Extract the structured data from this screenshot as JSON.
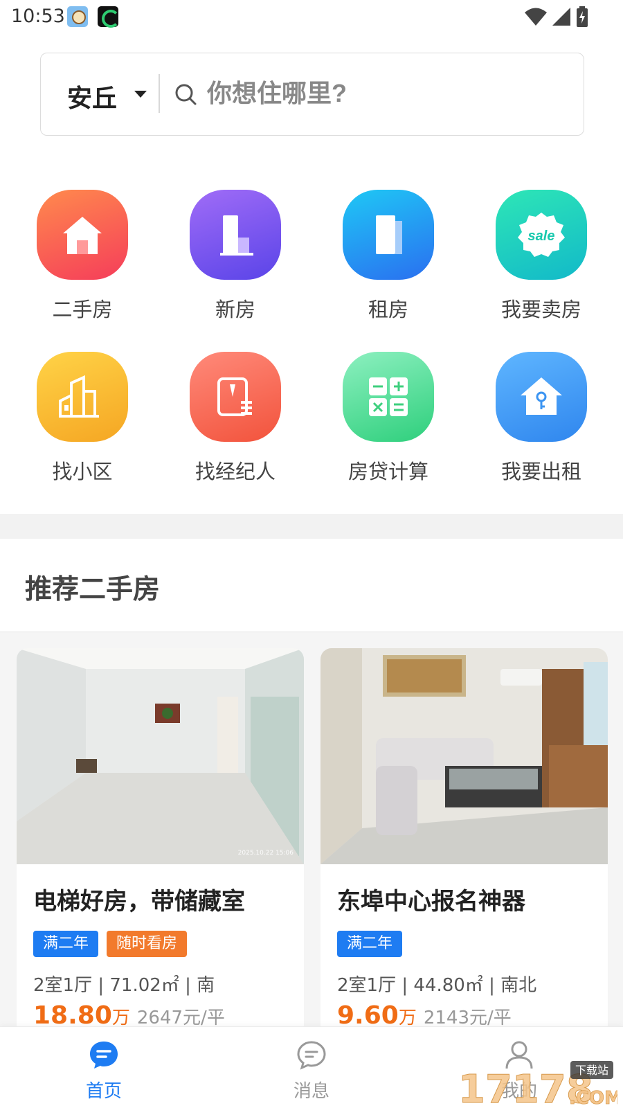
{
  "status_bar": {
    "time": "10:53"
  },
  "search": {
    "city": "安丘",
    "placeholder": "你想住哪里?"
  },
  "features": [
    {
      "label": "二手房",
      "icon": "house-icon",
      "color": "#f54d4d"
    },
    {
      "label": "新房",
      "icon": "building-icon",
      "color": "#7a5cf5"
    },
    {
      "label": "租房",
      "icon": "rent-building-icon",
      "color": "#1f8df2"
    },
    {
      "label": "我要卖房",
      "icon": "sale-badge-icon",
      "color": "#19c9ae"
    },
    {
      "label": "找小区",
      "icon": "community-icon",
      "color": "#f7b82e"
    },
    {
      "label": "找经纪人",
      "icon": "agent-icon",
      "color": "#f5634c"
    },
    {
      "label": "房贷计算",
      "icon": "calculator-icon",
      "color": "#3ecf7e"
    },
    {
      "label": "我要出租",
      "icon": "house-key-icon",
      "color": "#3b94f2"
    }
  ],
  "section": {
    "title": "推荐二手房"
  },
  "listings": [
    {
      "title": "电梯好房，带储藏室",
      "tags": [
        "满二年",
        "随时看房"
      ],
      "meta": "2室1厅 | 71.02㎡ | 南",
      "price": "18.80",
      "price_unit": "万",
      "unit_price": "2647元/平",
      "photo_stamp": "2025.10.22  15:06"
    },
    {
      "title": "东埠中心报名神器",
      "tags": [
        "满二年"
      ],
      "meta": "2室1厅 | 44.80㎡ | 南北",
      "price": "9.60",
      "price_unit": "万",
      "unit_price": "2143元/平"
    }
  ],
  "bottom_nav": [
    {
      "label": "首页",
      "icon": "home-chat-icon",
      "active": true
    },
    {
      "label": "消息",
      "icon": "message-icon",
      "active": false
    },
    {
      "label": "我的",
      "icon": "profile-icon",
      "active": false
    }
  ],
  "watermark": {
    "text": "17178",
    "sub": "下载站",
    "domain": ".COM"
  },
  "colors": {
    "accent": "#1e7cf2",
    "price": "#f06c15",
    "tag_orange": "#f27a2c"
  }
}
